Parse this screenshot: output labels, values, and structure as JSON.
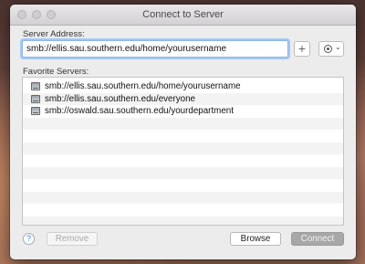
{
  "window": {
    "title": "Connect to Server"
  },
  "server_address": {
    "label": "Server Address:",
    "value": "smb://ellis.sau.southern.edu/home/yourusername"
  },
  "toolbar": {
    "add_icon": "plus-icon",
    "action_icon": "gear-icon"
  },
  "favorites": {
    "label": "Favorite Servers:",
    "items": [
      {
        "label": "smb://ellis.sau.southern.edu/home/yourusername",
        "icon": "server-icon"
      },
      {
        "label": "smb://ellis.sau.southern.edu/everyone",
        "icon": "server-icon"
      },
      {
        "label": "smb://oswald.sau.southern.edu/yourdepartment",
        "icon": "server-icon"
      }
    ]
  },
  "footer": {
    "help": "?",
    "remove": "Remove",
    "browse": "Browse",
    "connect": "Connect"
  }
}
